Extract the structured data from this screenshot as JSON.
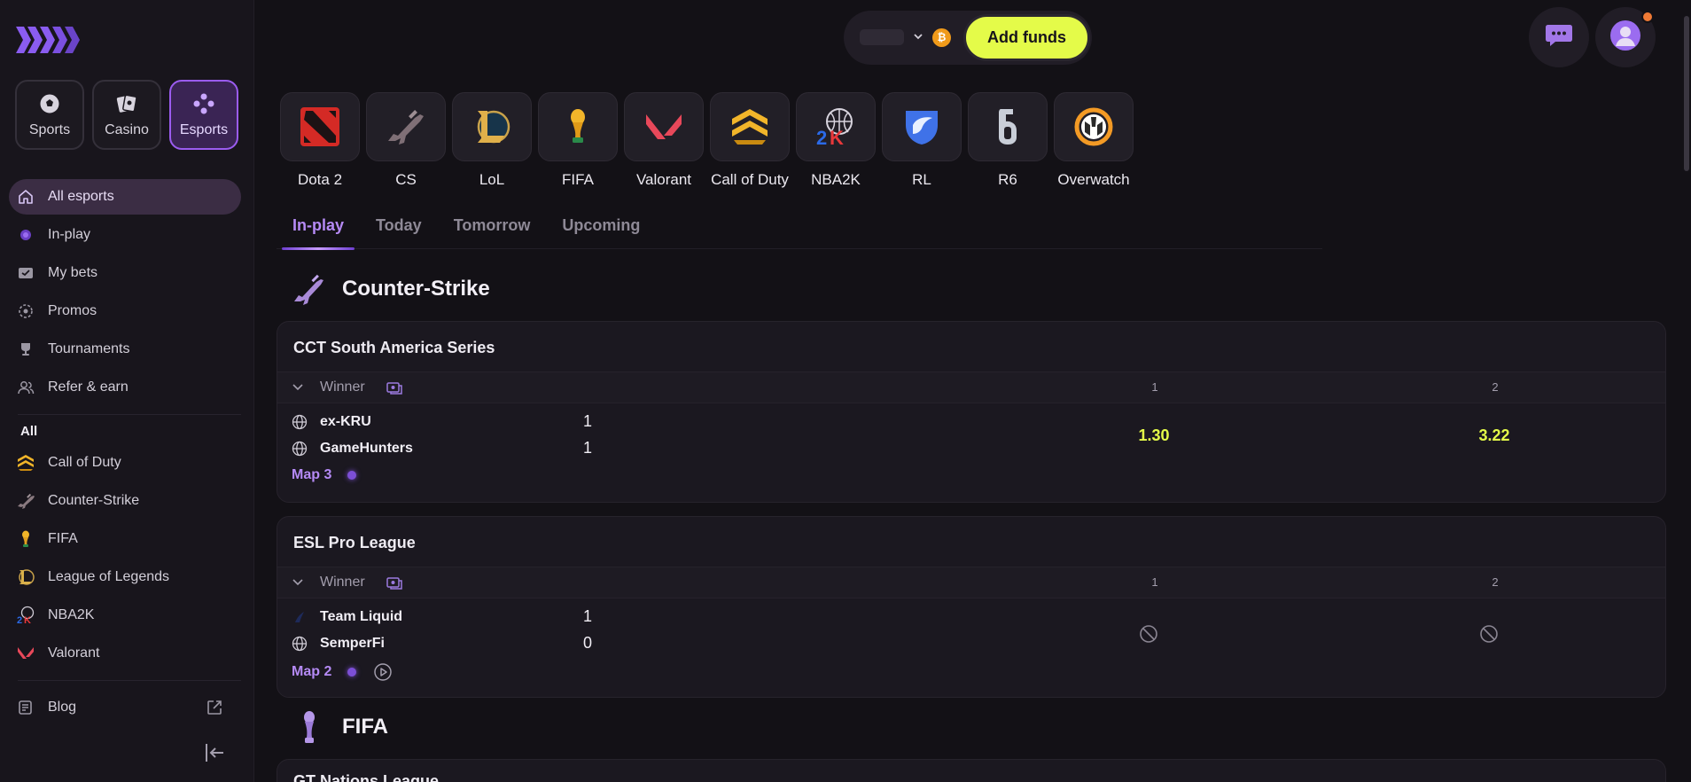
{
  "sidebar": {
    "logo_name": "brand-logo",
    "categories": [
      {
        "label": "Sports",
        "icon": "soccer-ball-icon"
      },
      {
        "label": "Casino",
        "icon": "cards-icon"
      },
      {
        "label": "Esports",
        "icon": "gamepad-icon"
      }
    ],
    "nav": [
      {
        "label": "All esports",
        "icon": "home-icon"
      },
      {
        "label": "In-play",
        "icon": "live-dot-icon"
      },
      {
        "label": "My bets",
        "icon": "ticket-icon"
      },
      {
        "label": "Promos",
        "icon": "promo-icon"
      },
      {
        "label": "Tournaments",
        "icon": "trophy-icon"
      },
      {
        "label": "Refer & earn",
        "icon": "users-icon"
      }
    ],
    "all_label": "All",
    "games": [
      {
        "label": "Call of Duty"
      },
      {
        "label": "Counter-Strike"
      },
      {
        "label": "FIFA"
      },
      {
        "label": "League of Legends"
      },
      {
        "label": "NBA2K"
      },
      {
        "label": "Valorant"
      }
    ],
    "blog_label": "Blog"
  },
  "header": {
    "add_funds_label": "Add funds",
    "coin_symbol": "₿"
  },
  "games": [
    {
      "label": "Dota 2"
    },
    {
      "label": "CS"
    },
    {
      "label": "LoL"
    },
    {
      "label": "FIFA"
    },
    {
      "label": "Valorant"
    },
    {
      "label": "Call of Duty"
    },
    {
      "label": "NBA2K"
    },
    {
      "label": "RL"
    },
    {
      "label": "R6"
    },
    {
      "label": "Overwatch"
    }
  ],
  "tabs": [
    {
      "label": "In-play"
    },
    {
      "label": "Today"
    },
    {
      "label": "Tomorrow"
    },
    {
      "label": "Upcoming"
    }
  ],
  "sections": [
    {
      "title": "Counter-Strike",
      "matches": [
        {
          "league": "CCT South America Series",
          "market": "Winner",
          "col1": "1",
          "col2": "2",
          "team1": {
            "name": "ex-KRU",
            "score": "1"
          },
          "team2": {
            "name": "GameHunters",
            "score": "1"
          },
          "odd1": "1.30",
          "odd2": "3.22",
          "map": "Map 3"
        },
        {
          "league": "ESL Pro League",
          "market": "Winner",
          "col1": "1",
          "col2": "2",
          "team1": {
            "name": "Team Liquid",
            "score": "1"
          },
          "team2": {
            "name": "SemperFi",
            "score": "0"
          },
          "map": "Map 2"
        }
      ]
    },
    {
      "title": "FIFA",
      "matches": [
        {
          "league": "GT Nations League"
        }
      ]
    }
  ],
  "colors": {
    "accent": "#b58af5",
    "odds": "#e4fb49",
    "background": "#131116"
  }
}
